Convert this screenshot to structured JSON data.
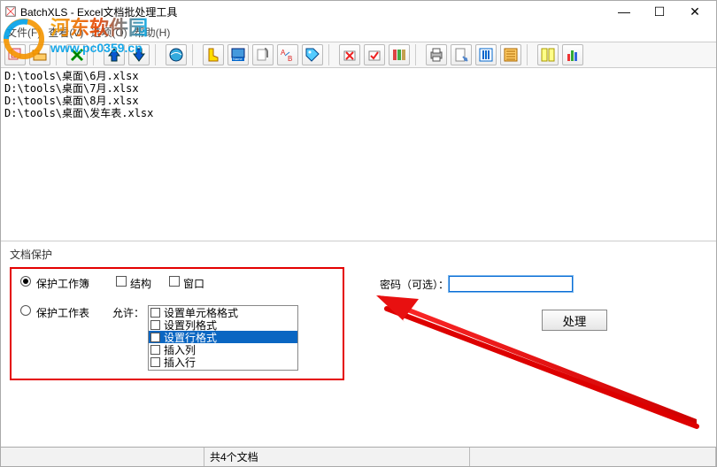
{
  "title": "BatchXLS - Excel文档批处理工具",
  "window_buttons": {
    "min": "—",
    "max": "☐",
    "close": "✕"
  },
  "menu": {
    "file": "文件(F)",
    "view": "查看(V)",
    "options": "选项(O)",
    "help": "帮助(H)"
  },
  "watermark": {
    "brand": "河东软件园",
    "url": "www.pc0359.cn"
  },
  "files": [
    "D:\\tools\\桌面\\6月.xlsx",
    "D:\\tools\\桌面\\7月.xlsx",
    "D:\\tools\\桌面\\8月.xlsx",
    "D:\\tools\\桌面\\发车表.xlsx"
  ],
  "panel": {
    "title": "文档保护"
  },
  "protect": {
    "workbook": {
      "label": "保护工作簿",
      "checked": true
    },
    "structure": "结构",
    "window": "窗口",
    "worksheet": {
      "label": "保护工作表",
      "checked": false
    },
    "allow_label": "允许：",
    "allow_items": [
      {
        "label": "设置单元格格式",
        "sel": false
      },
      {
        "label": "设置列格式",
        "sel": false
      },
      {
        "label": "设置行格式",
        "sel": true
      },
      {
        "label": "插入列",
        "sel": false
      },
      {
        "label": "插入行",
        "sel": false
      }
    ]
  },
  "password": {
    "label": "密码（可选）：",
    "value": ""
  },
  "process_button": "处理",
  "status": {
    "count": "共4个文档"
  }
}
